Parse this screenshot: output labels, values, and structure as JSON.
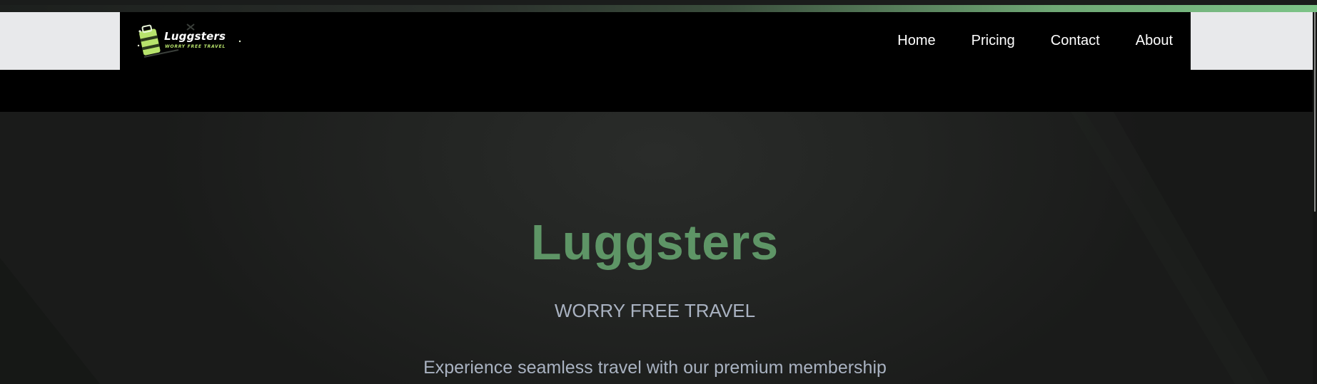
{
  "header": {
    "logo": {
      "name": "Luggsters",
      "tagline": "WORRY FREE TRAVEL"
    },
    "nav": [
      {
        "label": "Home"
      },
      {
        "label": "Pricing"
      },
      {
        "label": "Contact"
      },
      {
        "label": "About"
      }
    ]
  },
  "hero": {
    "title": "Luggsters",
    "subtitle": "WORRY FREE TRAVEL",
    "description": "Experience seamless travel with our premium membership"
  },
  "colors": {
    "brand_green": "#5e9566",
    "accent_green": "#7cc487",
    "text_muted": "#a9b2c1",
    "nav_background": "#000000"
  }
}
